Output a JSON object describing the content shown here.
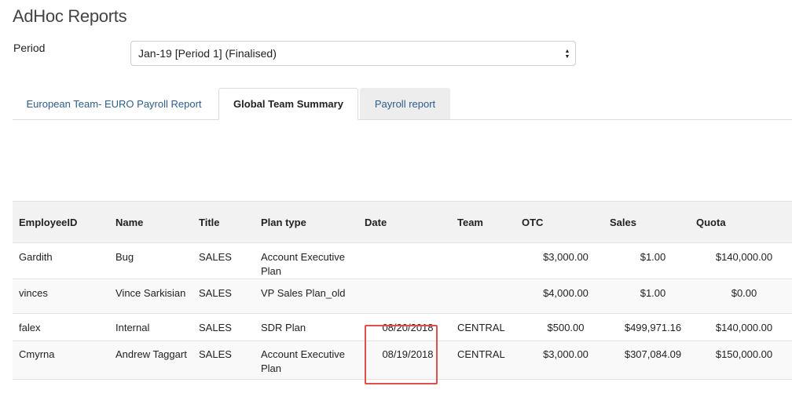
{
  "header": {
    "title": "AdHoc Reports"
  },
  "period": {
    "label": "Period",
    "selected": "Jan-19 [Period 1] (Finalised)",
    "caret_up": "▲",
    "caret_down": "▼"
  },
  "tabs": [
    {
      "label": "European Team- EURO Payroll Report",
      "active": false
    },
    {
      "label": "Global Team Summary",
      "active": true
    },
    {
      "label": "Payroll report",
      "active": false
    }
  ],
  "table": {
    "columns": [
      "EmployeeID",
      "Name",
      "Title",
      "Plan type",
      "Date",
      "Team",
      "OTC",
      "Sales",
      "Quota"
    ],
    "rows": [
      {
        "employee_id": "Gardith",
        "name": "Bug",
        "title": "SALES",
        "plan_type": "Account Executive Plan",
        "date": "",
        "team": "",
        "otc": "$3,000.00",
        "sales": "$1.00",
        "quota": "$140,000.00"
      },
      {
        "employee_id": "vinces",
        "name": "Vince Sarkisian",
        "title": "SALES",
        "plan_type": "VP Sales Plan_old",
        "date": "",
        "team": "",
        "otc": "$4,000.00",
        "sales": "$1.00",
        "quota": "$0.00"
      },
      {
        "employee_id": "falex",
        "name": "Internal",
        "title": "SALES",
        "plan_type": "SDR Plan",
        "date": "08/20/2018",
        "team": "CENTRAL",
        "otc": "$500.00",
        "sales": "$499,971.16",
        "quota": "$140,000.00"
      },
      {
        "employee_id": "Cmyrna",
        "name": "Andrew Taggart",
        "title": "SALES",
        "plan_type": "Account Executive Plan",
        "date": "08/19/2018",
        "team": "CENTRAL",
        "otc": "$3,000.00",
        "sales": "$307,084.09",
        "quota": "$150,000.00"
      }
    ]
  },
  "colors": {
    "highlight": "#e0504a",
    "link": "#2d5d8a"
  }
}
